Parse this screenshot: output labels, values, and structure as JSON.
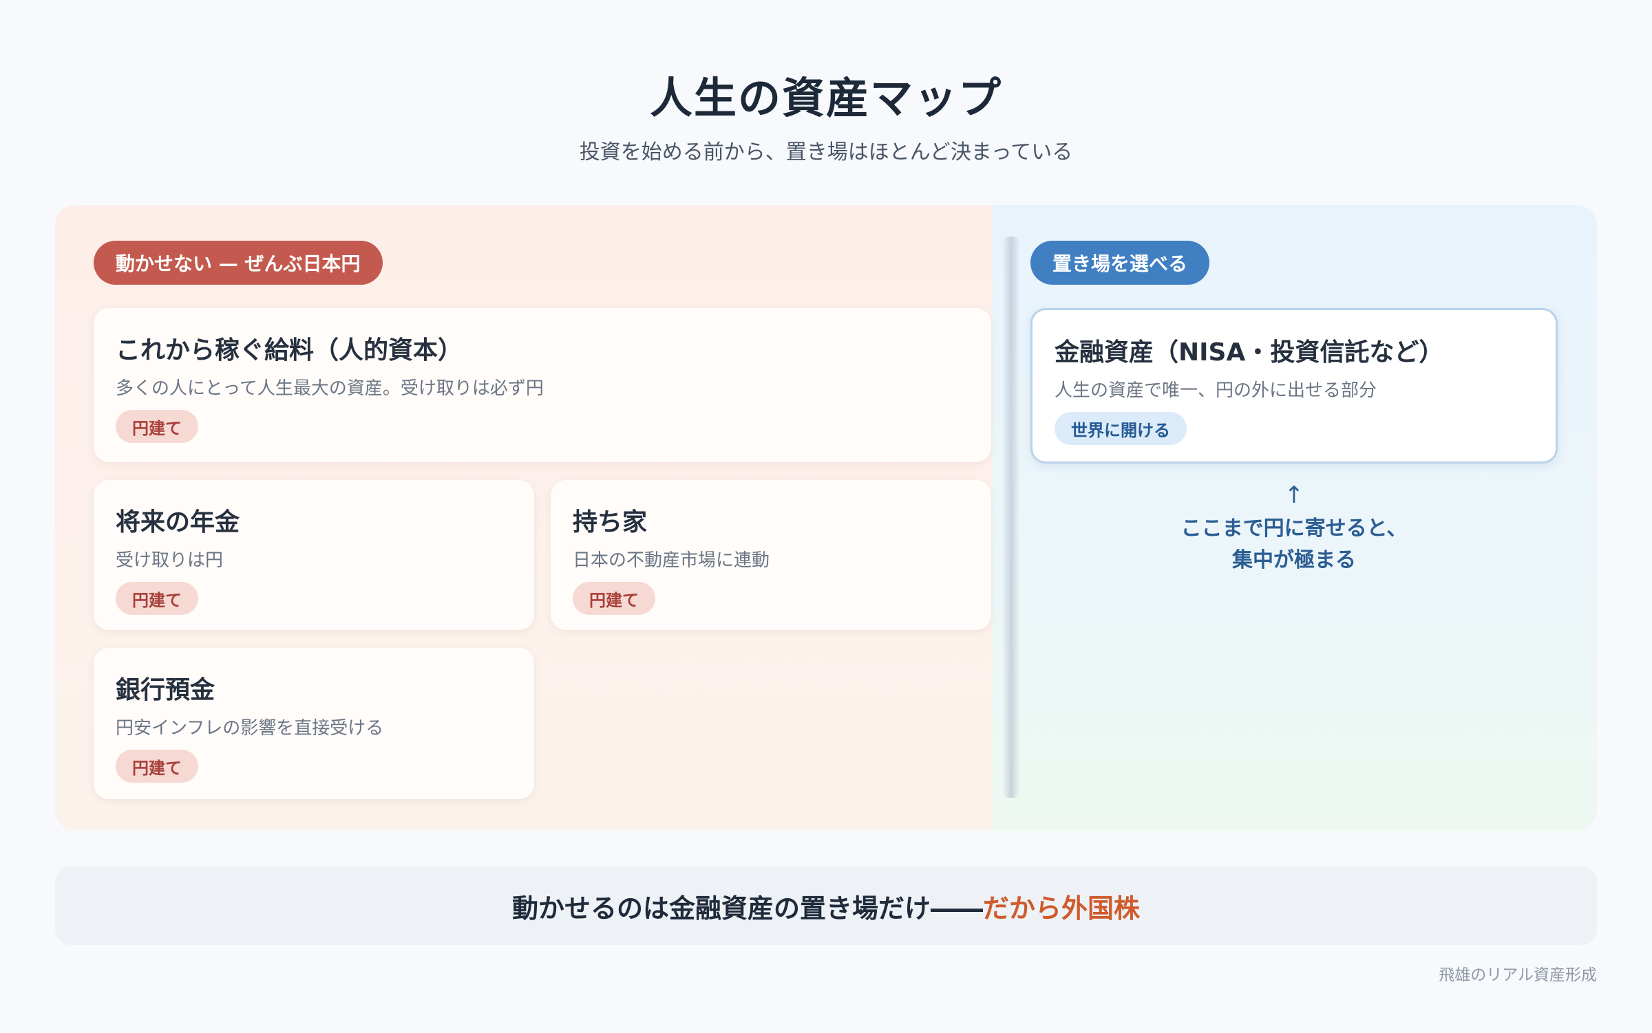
{
  "header": {
    "title": "人生の資産マップ",
    "subtitle": "投資を始める前から、置き場はほとんど決まっている"
  },
  "zones": {
    "left": {
      "label": "動かせない — ぜんぶ日本円",
      "color": "#c45a4f"
    },
    "right": {
      "label": "置き場を選べる",
      "color": "#3f7fc2"
    }
  },
  "cards": [
    {
      "title": "これから稼ぐ給料（人的資本）",
      "desc": "多くの人にとって人生最大の資産。受け取りは必ず円",
      "tag": "円建て"
    },
    {
      "title": "将来の年金",
      "desc": "受け取りは円",
      "tag": "円建て"
    },
    {
      "title": "持ち家",
      "desc": "日本の不動産市場に連動",
      "tag": "円建て"
    },
    {
      "title": "銀行預金",
      "desc": "円安インフレの影響を直接受ける",
      "tag": "円建て"
    },
    {
      "title": "金融資産（NISA・投資信託など）",
      "desc": "人生の資産で唯一、円の外に出せる部分",
      "tag": "世界に開ける"
    }
  ],
  "note": {
    "arrow": "↑",
    "line1": "ここまで円に寄せると、",
    "line2": "集中が極まる"
  },
  "footer": {
    "main": "動かせるのは金融資産の置き場だけ――",
    "accent": "だから外国株",
    "accent_color": "#cf5a2c"
  },
  "credit": "飛雄のリアル資産形成"
}
